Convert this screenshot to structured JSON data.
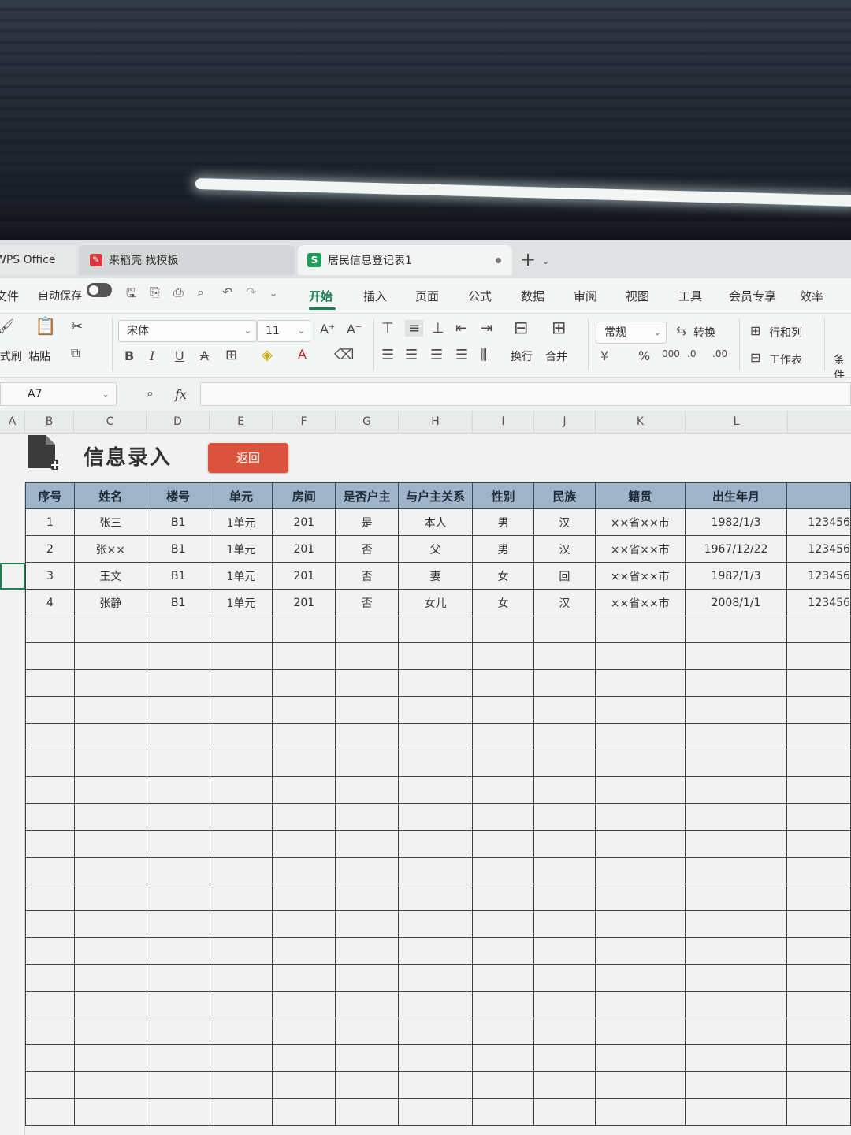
{
  "titlebar": {
    "app_tab": "WPS Office",
    "template_tab": "来稻壳 找模板",
    "doc_tab": "居民信息登记表1",
    "doc_icon_letter": "S",
    "new_tab": "+"
  },
  "quickbar": {
    "file_label": "文件",
    "autosave_label": "自动保存"
  },
  "menu": [
    "开始",
    "插入",
    "页面",
    "公式",
    "数据",
    "审阅",
    "视图",
    "工具",
    "会员专享",
    "效率"
  ],
  "ribbon": {
    "format_painter": "格式刷",
    "paste": "粘贴",
    "font_name": "宋体",
    "font_size": "11",
    "wrap": "换行",
    "merge": "合并",
    "number_format": "常规",
    "convert": "转换",
    "row_col": "行和列",
    "worksheet": "工作表",
    "conditional": "条件"
  },
  "formula_bar": {
    "cell_ref": "A7",
    "fx": "fx",
    "value": ""
  },
  "columns": [
    "A",
    "B",
    "C",
    "D",
    "E",
    "F",
    "G",
    "H",
    "I",
    "J",
    "K",
    "L"
  ],
  "sheet": {
    "title": "信息录入",
    "back_button": "返回",
    "headers": [
      "序号",
      "姓名",
      "楼号",
      "单元",
      "房间",
      "是否户主",
      "与户主关系",
      "性别",
      "民族",
      "籍贯",
      "出生年月",
      ""
    ],
    "rows": [
      [
        "1",
        "张三",
        "B1",
        "1单元",
        "201",
        "是",
        "本人",
        "男",
        "汉",
        "××省××市",
        "1982/1/3",
        "123456"
      ],
      [
        "2",
        "张××",
        "B1",
        "1单元",
        "201",
        "否",
        "父",
        "男",
        "汉",
        "××省××市",
        "1967/12/22",
        "123456"
      ],
      [
        "3",
        "王文",
        "B1",
        "1单元",
        "201",
        "否",
        "妻",
        "女",
        "回",
        "××省××市",
        "1982/1/3",
        "123456"
      ],
      [
        "4",
        "张静",
        "B1",
        "1单元",
        "201",
        "否",
        "女儿",
        "女",
        "汉",
        "××省××市",
        "2008/1/1",
        "123456"
      ]
    ],
    "empty_rows": 19
  },
  "colors": {
    "accent": "#1b7f54",
    "header_fill": "#9fb3c9",
    "back_button": "#d9533d"
  }
}
